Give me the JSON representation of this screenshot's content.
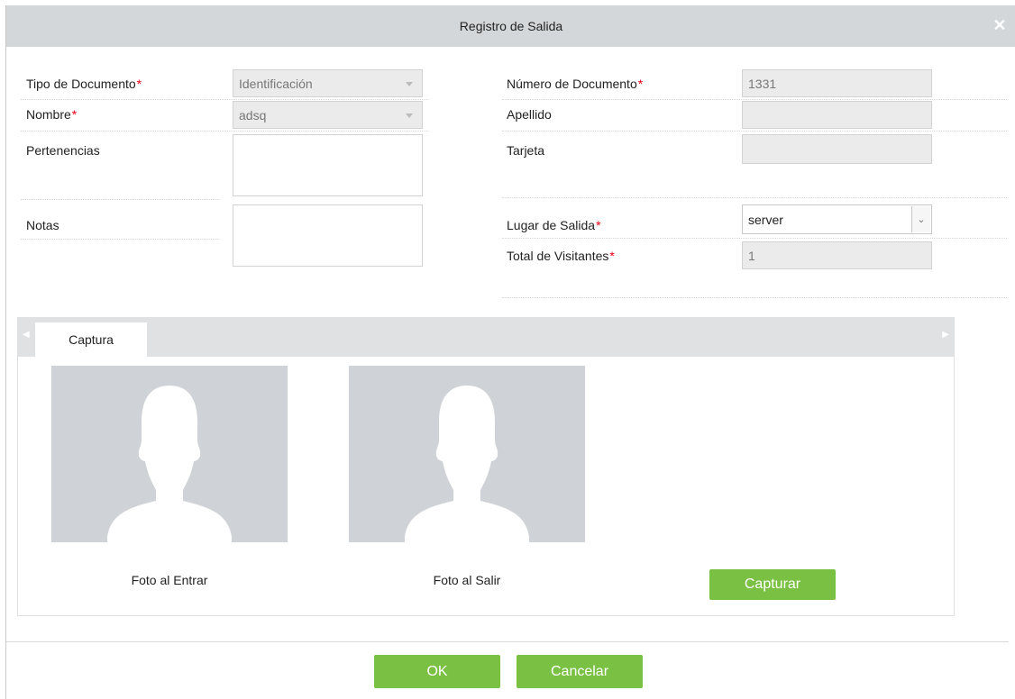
{
  "dialog": {
    "title": "Registro de Salida",
    "close_icon": "close-icon"
  },
  "form": {
    "tipo_documento": {
      "label": "Tipo de Documento",
      "required": "*",
      "value": "Identificación"
    },
    "nombre": {
      "label": "Nombre",
      "required": "*",
      "value": "adsq"
    },
    "pertenencias": {
      "label": "Pertenencias",
      "value": ""
    },
    "notas": {
      "label": "Notas",
      "value": ""
    },
    "numero_documento": {
      "label": "Número de Documento",
      "required": "*",
      "value": "1331"
    },
    "apellido": {
      "label": "Apellido",
      "value": ""
    },
    "tarjeta": {
      "label": "Tarjeta",
      "value": ""
    },
    "lugar_salida": {
      "label": "Lugar de Salida",
      "required": "*",
      "value": "server"
    },
    "total_visitantes": {
      "label": "Total de Visitantes",
      "required": "*",
      "value": "1"
    }
  },
  "capture": {
    "tab_label": "Captura",
    "photo_in_caption": "Foto al Entrar",
    "photo_out_caption": "Foto al Salir",
    "capture_button": "Capturar"
  },
  "footer": {
    "ok_label": "OK",
    "cancel_label": "Cancelar"
  },
  "colors": {
    "accent_green": "#7ac143",
    "required_red": "#e60012",
    "titlebar_gray": "#d4d7d9"
  }
}
